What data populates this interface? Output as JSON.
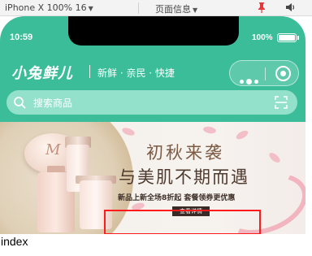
{
  "devtools": {
    "device_label": "iPhone X 100% 16",
    "page_info_label": "页面信息"
  },
  "status_bar": {
    "time": "10:59",
    "battery_percent": "100%"
  },
  "nav": {
    "logo_text": "小兔鲜儿",
    "slogan": "新鲜 · 亲民 · 快捷"
  },
  "search": {
    "placeholder": "搜索商品"
  },
  "banner": {
    "title_line1": "初秋来袭",
    "title_line2": "与美肌不期而遇",
    "subtitle": "新品上新全场8折起 套餐领券更优惠",
    "cta": "查看详情",
    "slide_count": 3,
    "active_slide": 1
  },
  "page_label": "index",
  "colors": {
    "header_green": "#3cbd9a",
    "search_bg": "#93e0cb",
    "annotation_red": "#ff1b1b"
  }
}
